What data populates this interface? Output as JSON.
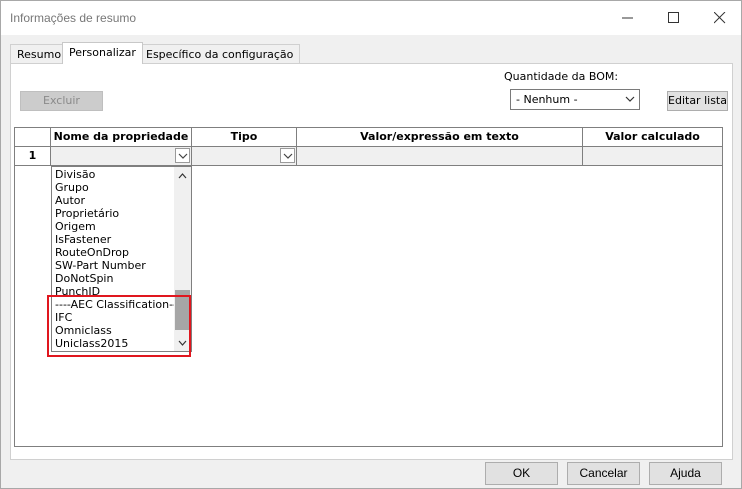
{
  "window": {
    "title": "Informações de resumo"
  },
  "tabs": [
    {
      "label": "Resumo",
      "active": false
    },
    {
      "label": "Personalizar",
      "active": true
    },
    {
      "label": "Específico da configuração",
      "active": false
    }
  ],
  "toolbar": {
    "delete_label": "Excluir",
    "bom_quantity_label": "Quantidade da BOM:",
    "bom_quantity_value": "- Nenhum -",
    "edit_list_label": "Editar lista"
  },
  "grid": {
    "headers": [
      "Nome da propriedade",
      "Tipo",
      "Valor/expressão em texto",
      "Valor calculado"
    ],
    "row_number": "1"
  },
  "property_dropdown": {
    "items": [
      "Divisão",
      "Grupo",
      "Autor",
      "Proprietário",
      "Origem",
      "IsFastener",
      "RouteOnDrop",
      "SW-Part Number",
      "DoNotSpin",
      "PunchID",
      "----AEC Classification---",
      "IFC",
      "Omniclass",
      "Uniclass2015"
    ]
  },
  "buttons": {
    "ok": "OK",
    "cancel": "Cancelar",
    "help": "Ajuda"
  },
  "colors": {
    "highlight": "#e0161e"
  },
  "icons": [
    "minimize-icon",
    "maximize-icon",
    "close-icon",
    "chevron-down-icon",
    "scroll-up-icon",
    "scroll-down-icon"
  ]
}
